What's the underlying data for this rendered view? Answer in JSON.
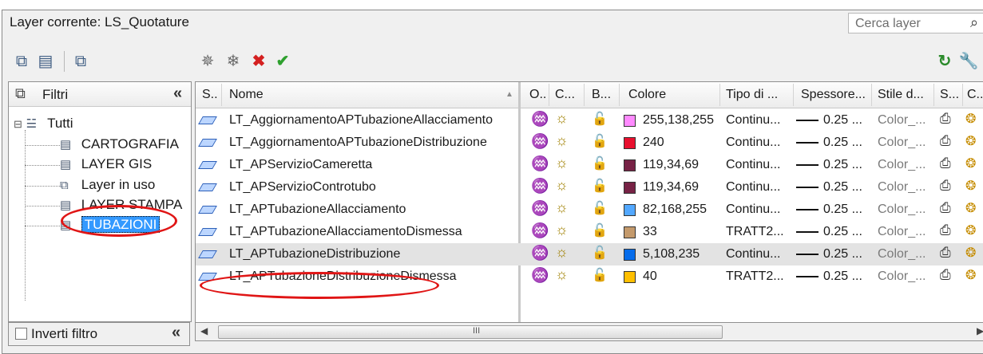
{
  "header": {
    "current_layer": "Layer corrente: LS_Quotature",
    "search_placeholder": "Cerca layer"
  },
  "toolbar_icons": [
    "new-property-filter-icon",
    "new-group-filter-icon",
    "layer-states-manager-icon",
    "new-layer-icon",
    "new-layer-vp-frozen-icon",
    "delete-layer-icon",
    "set-current-icon",
    "refresh-icon",
    "settings-icon"
  ],
  "filters_panel": {
    "title": "Filtri",
    "collapse_glyph": "«",
    "root": "Tutti",
    "items": [
      "CARTOGRAFIA",
      "LAYER GIS",
      "Layer in uso",
      "LAYER STAMPA",
      "TUBAZIONI"
    ],
    "selected": "TUBAZIONI",
    "invert_label": "Inverti filtro"
  },
  "columns": {
    "stato": "S..",
    "nome": "Nome",
    "on": "O..",
    "congela": "C...",
    "blocca": "B...",
    "colore": "Colore",
    "tipolinea": "Tipo di ...",
    "spessore": "Spessore...",
    "stile": "Stile d...",
    "stampa": "S...",
    "nuovo": "C.."
  },
  "layers": [
    {
      "name": "LT_AggiornamentoAPTubazioneAllacciamento",
      "color_label": "255,138,255",
      "color_hex": "#ff8aff",
      "linetype": "Continu...",
      "lineweight": "0.25 ...",
      "plotstyle": "Color_..."
    },
    {
      "name": "LT_AggiornamentoAPTubazioneDistribuzione",
      "color_label": "240",
      "color_hex": "#e8102e",
      "linetype": "Continu...",
      "lineweight": "0.25 ...",
      "plotstyle": "Color_..."
    },
    {
      "name": "LT_APServizioCameretta",
      "color_label": "119,34,69",
      "color_hex": "#772245",
      "linetype": "Continu...",
      "lineweight": "0.25 ...",
      "plotstyle": "Color_..."
    },
    {
      "name": "LT_APServizioControtubo",
      "color_label": "119,34,69",
      "color_hex": "#772245",
      "linetype": "Continu...",
      "lineweight": "0.25 ...",
      "plotstyle": "Color_..."
    },
    {
      "name": "LT_APTubazioneAllacciamento",
      "color_label": "82,168,255",
      "color_hex": "#52a8ff",
      "linetype": "Continu...",
      "lineweight": "0.25 ...",
      "plotstyle": "Color_..."
    },
    {
      "name": "LT_APTubazioneAllacciamentoDismessa",
      "color_label": "33",
      "color_hex": "#c49a6c",
      "linetype": "TRATT2...",
      "lineweight": "0.25 ...",
      "plotstyle": "Color_..."
    },
    {
      "name": "LT_APTubazioneDistribuzione",
      "color_label": "5,108,235",
      "color_hex": "#056ceb",
      "linetype": "Continu...",
      "lineweight": "0.25 ...",
      "plotstyle": "Color_..."
    },
    {
      "name": "LT_APTubazioneDistribuzioneDismessa",
      "color_label": "40",
      "color_hex": "#ffbf00",
      "linetype": "TRATT2...",
      "lineweight": "0.25 ...",
      "plotstyle": "Color_..."
    }
  ],
  "selected_layer": "LT_APTubazioneDistribuzione",
  "highlight_color": "#e01515",
  "scrollbar_grip": "III"
}
